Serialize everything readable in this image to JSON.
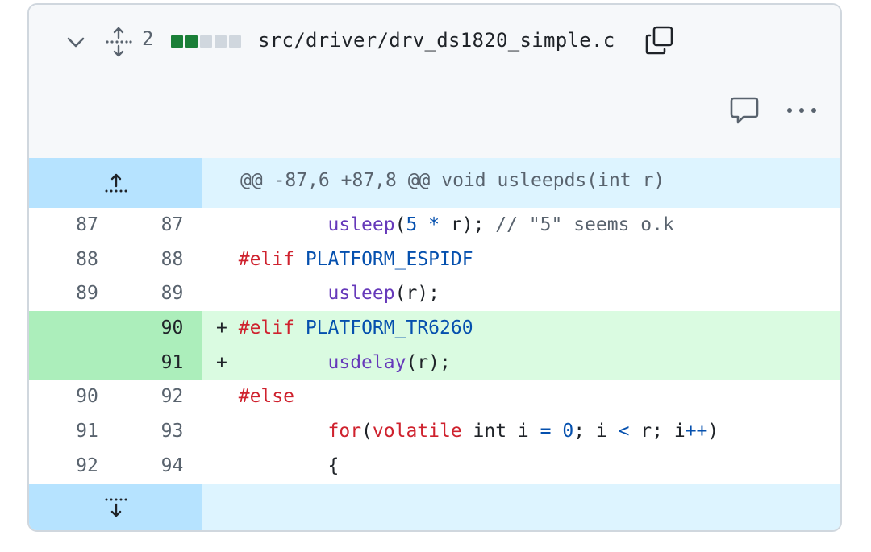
{
  "header": {
    "change_count": "2",
    "diffstat": [
      "added",
      "added",
      "neutral",
      "neutral",
      "neutral"
    ],
    "filename": "src/driver/drv_ds1820_simple.c",
    "icons": {
      "collapse": "chevron-down-icon",
      "expand_all": "unfold-icon",
      "copy": "copy-icon",
      "comment": "comment-icon",
      "more": "kebab-horizontal-icon"
    }
  },
  "colors": {
    "diffstat_added": "#1a7f37",
    "diffstat_neutral": "#d0d7de",
    "addition_bg": "#dafbe1",
    "addition_gutter": "#aceebb",
    "hunk_bg": "#ddf4ff",
    "hunk_gutter": "#b6e3ff"
  },
  "hunk_header": "@@ -87,6 +87,8 @@ void usleepds(int r)",
  "lines": [
    {
      "old": "87",
      "new": "87",
      "marker": " ",
      "type": "context",
      "tokens": [
        [
          "        ",
          ""
        ],
        [
          "usleep",
          "fn"
        ],
        [
          "(",
          ""
        ],
        [
          "5",
          "cst"
        ],
        [
          " ",
          ""
        ],
        [
          "*",
          "cst"
        ],
        [
          " r); ",
          ""
        ],
        [
          "// \"5\" seems o.k",
          "cm"
        ]
      ]
    },
    {
      "old": "88",
      "new": "88",
      "marker": " ",
      "type": "context",
      "tokens": [
        [
          "#elif",
          "kw"
        ],
        [
          " ",
          ""
        ],
        [
          "PLATFORM_ESPIDF",
          "cst"
        ]
      ]
    },
    {
      "old": "89",
      "new": "89",
      "marker": " ",
      "type": "context",
      "tokens": [
        [
          "        ",
          ""
        ],
        [
          "usleep",
          "fn"
        ],
        [
          "(r);",
          ""
        ]
      ]
    },
    {
      "old": "",
      "new": "90",
      "marker": "+",
      "type": "addition",
      "tokens": [
        [
          "#elif",
          "kw"
        ],
        [
          " ",
          ""
        ],
        [
          "PLATFORM_TR6260",
          "cst"
        ]
      ]
    },
    {
      "old": "",
      "new": "91",
      "marker": "+",
      "type": "addition",
      "tokens": [
        [
          "        ",
          ""
        ],
        [
          "usdelay",
          "fn"
        ],
        [
          "(r);",
          ""
        ]
      ]
    },
    {
      "old": "90",
      "new": "92",
      "marker": " ",
      "type": "context",
      "tokens": [
        [
          "#else",
          "kw"
        ]
      ]
    },
    {
      "old": "91",
      "new": "93",
      "marker": " ",
      "type": "context",
      "tokens": [
        [
          "        ",
          ""
        ],
        [
          "for",
          "kw"
        ],
        [
          "(",
          ""
        ],
        [
          "volatile",
          "kw"
        ],
        [
          " int i ",
          ""
        ],
        [
          "=",
          "cst"
        ],
        [
          " ",
          ""
        ],
        [
          "0",
          "cst"
        ],
        [
          "; i ",
          ""
        ],
        [
          "<",
          "cst"
        ],
        [
          " r; i",
          ""
        ],
        [
          "++",
          "cst"
        ],
        [
          ")",
          ""
        ]
      ]
    },
    {
      "old": "92",
      "new": "94",
      "marker": " ",
      "type": "context",
      "tokens": [
        [
          "        {",
          ""
        ]
      ]
    }
  ]
}
